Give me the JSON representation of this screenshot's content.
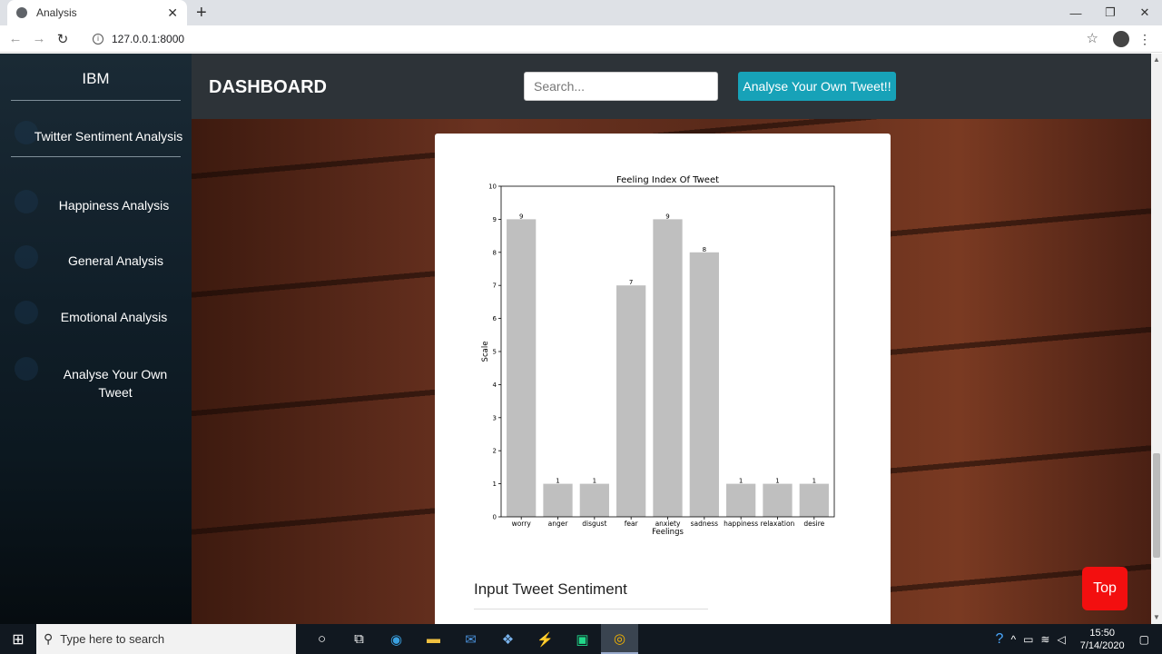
{
  "browser": {
    "tab_title": "Analysis",
    "url": "127.0.0.1:8000"
  },
  "sidebar": {
    "brand": "IBM",
    "section_title": "Twitter Sentiment Analysis",
    "items": [
      {
        "label": "Happiness Analysis"
      },
      {
        "label": "General Analysis"
      },
      {
        "label": "Emotional Analysis"
      },
      {
        "label": "Analyse Your Own Tweet"
      }
    ]
  },
  "header": {
    "title": "DASHBOARD",
    "search_placeholder": "Search...",
    "own_tweet_button": "Analyse Your Own Tweet!!"
  },
  "chart_data": {
    "type": "bar",
    "title": "Feeling Index Of Tweet",
    "xlabel": "Feelings",
    "ylabel": "Scale",
    "ylim": [
      0,
      10
    ],
    "yticks": [
      0,
      1,
      2,
      3,
      4,
      5,
      6,
      7,
      8,
      9,
      10
    ],
    "categories": [
      "worry",
      "anger",
      "disgust",
      "fear",
      "anxiety",
      "sadness",
      "happiness",
      "relaxation",
      "desire"
    ],
    "values": [
      9,
      1,
      1,
      7,
      9,
      8,
      1,
      1,
      1
    ],
    "bar_color": "#bfbfbf"
  },
  "section": {
    "title": "Input Tweet Sentiment"
  },
  "top_button": "Top",
  "taskbar": {
    "search_text": "Type here to search",
    "time": "15:50",
    "date": "7/14/2020"
  }
}
